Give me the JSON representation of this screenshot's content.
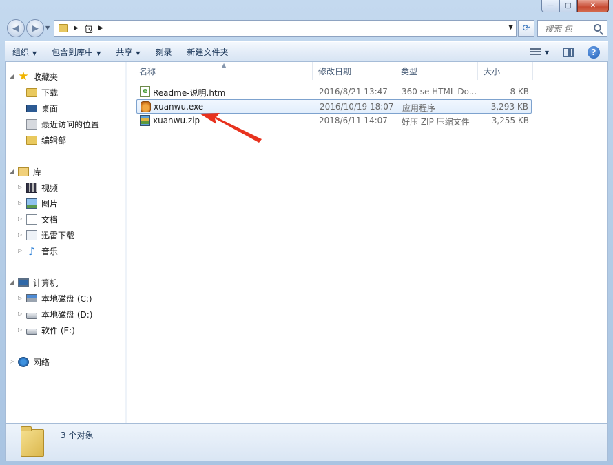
{
  "window": {
    "min_label": "—",
    "max_label": "▢",
    "close_label": "✕"
  },
  "address": {
    "path": "包",
    "search_placeholder": "搜索 包"
  },
  "toolbar": {
    "organize": "组织",
    "include_in_library": "包含到库中",
    "share": "共享",
    "burn": "刻录",
    "new_folder": "新建文件夹"
  },
  "sidebar": {
    "favorites": {
      "label": "收藏夹",
      "items": [
        "下载",
        "桌面",
        "最近访问的位置",
        "编辑部"
      ]
    },
    "libraries": {
      "label": "库",
      "items": [
        "视频",
        "图片",
        "文档",
        "迅雷下载",
        "音乐"
      ]
    },
    "computer": {
      "label": "计算机",
      "items": [
        "本地磁盘 (C:)",
        "本地磁盘 (D:)",
        "软件 (E:)"
      ]
    },
    "network": {
      "label": "网络"
    }
  },
  "file_list": {
    "columns": [
      "名称",
      "修改日期",
      "类型",
      "大小"
    ],
    "rows": [
      {
        "name": "Readme-说明.htm",
        "date": "2016/8/21 13:47",
        "type": "360 se HTML Do...",
        "size": "8 KB",
        "icon": "htm-file-icon"
      },
      {
        "name": "xuanwu.exe",
        "date": "2016/10/19 18:07",
        "type": "应用程序",
        "size": "3,293 KB",
        "icon": "exe-file-icon"
      },
      {
        "name": "xuanwu.zip",
        "date": "2018/6/11 14:07",
        "type": "好压 ZIP 压缩文件",
        "size": "3,255 KB",
        "icon": "zip-file-icon"
      }
    ],
    "selected_row": 1
  },
  "status": {
    "count": "3 个对象"
  },
  "colors": {
    "annotation_arrow": "#e8321e",
    "selection_border": "#7da2ce"
  }
}
